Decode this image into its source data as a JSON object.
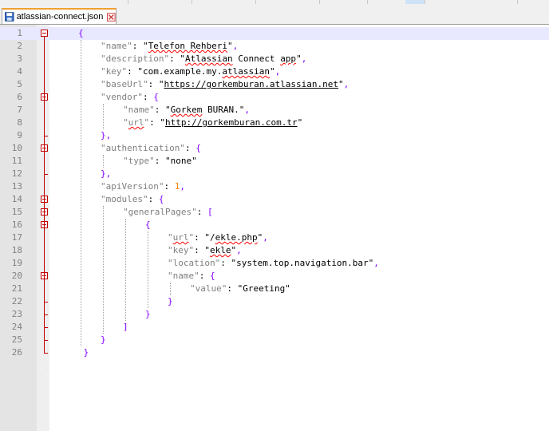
{
  "tab": {
    "title": "atlassian-connect.json",
    "icon": "save-icon",
    "close_icon": "close-icon"
  },
  "editor": {
    "current_line": 1,
    "lines": [
      {
        "n": "1",
        "indent": 0,
        "fold": "open",
        "tokens": [
          {
            "t": "{",
            "c": "p"
          }
        ]
      },
      {
        "n": "2",
        "indent": 1,
        "tokens": [
          {
            "t": "\"name\"",
            "c": "key"
          },
          {
            "t": ": ",
            "c": "kn"
          },
          {
            "t": "\"",
            "c": "q"
          },
          {
            "t": "Telefon Rehberi",
            "c": "sv sq"
          },
          {
            "t": "\"",
            "c": "q"
          },
          {
            "t": ",",
            "c": "p"
          }
        ]
      },
      {
        "n": "3",
        "indent": 1,
        "tokens": [
          {
            "t": "\"description\"",
            "c": "key"
          },
          {
            "t": ": ",
            "c": "kn"
          },
          {
            "t": "\"",
            "c": "q"
          },
          {
            "t": "Atlassian",
            "c": "sv sq"
          },
          {
            "t": " Connect ",
            "c": "sv"
          },
          {
            "t": "app",
            "c": "sv sq"
          },
          {
            "t": "\"",
            "c": "q"
          },
          {
            "t": ",",
            "c": "p"
          }
        ]
      },
      {
        "n": "4",
        "indent": 1,
        "tokens": [
          {
            "t": "\"key\"",
            "c": "key"
          },
          {
            "t": ": ",
            "c": "kn"
          },
          {
            "t": "\"com.example.my.",
            "c": "sv"
          },
          {
            "t": "atlassian",
            "c": "sv sq"
          },
          {
            "t": "\"",
            "c": "q"
          },
          {
            "t": ",",
            "c": "p"
          }
        ]
      },
      {
        "n": "5",
        "indent": 1,
        "tokens": [
          {
            "t": "\"baseUrl\"",
            "c": "key"
          },
          {
            "t": ": ",
            "c": "kn"
          },
          {
            "t": "\"",
            "c": "q"
          },
          {
            "t": "https://gorkemburan.atlassian.net",
            "c": "sv link"
          },
          {
            "t": "\"",
            "c": "q"
          },
          {
            "t": ",",
            "c": "p"
          }
        ]
      },
      {
        "n": "6",
        "indent": 1,
        "fold": "open",
        "tokens": [
          {
            "t": "\"vendor\"",
            "c": "key"
          },
          {
            "t": ": ",
            "c": "kn"
          },
          {
            "t": "{",
            "c": "p"
          }
        ]
      },
      {
        "n": "7",
        "indent": 2,
        "tokens": [
          {
            "t": "\"name\"",
            "c": "key"
          },
          {
            "t": ": ",
            "c": "kn"
          },
          {
            "t": "\"",
            "c": "q"
          },
          {
            "t": "Gorkem",
            "c": "sv sq"
          },
          {
            "t": " BURAN.\"",
            "c": "sv"
          },
          {
            "t": ",",
            "c": "p"
          }
        ]
      },
      {
        "n": "8",
        "indent": 2,
        "tokens": [
          {
            "t": "\"",
            "c": "key"
          },
          {
            "t": "url",
            "c": "key sq"
          },
          {
            "t": "\"",
            "c": "key"
          },
          {
            "t": ": ",
            "c": "kn"
          },
          {
            "t": "\"",
            "c": "q"
          },
          {
            "t": "http://gorkemburan.com.tr",
            "c": "sv link"
          },
          {
            "t": "\"",
            "c": "q"
          }
        ]
      },
      {
        "n": "9",
        "indent": 1,
        "fold": "end",
        "tokens": [
          {
            "t": "},",
            "c": "p"
          }
        ]
      },
      {
        "n": "10",
        "indent": 1,
        "fold": "open",
        "tokens": [
          {
            "t": "\"authentication\"",
            "c": "key"
          },
          {
            "t": ": ",
            "c": "kn"
          },
          {
            "t": "{",
            "c": "p"
          }
        ]
      },
      {
        "n": "11",
        "indent": 2,
        "tokens": [
          {
            "t": "\"type\"",
            "c": "key"
          },
          {
            "t": ": ",
            "c": "kn"
          },
          {
            "t": "\"none\"",
            "c": "sv"
          }
        ]
      },
      {
        "n": "12",
        "indent": 1,
        "fold": "end",
        "tokens": [
          {
            "t": "},",
            "c": "p"
          }
        ]
      },
      {
        "n": "13",
        "indent": 1,
        "tokens": [
          {
            "t": "\"apiVersion\"",
            "c": "key"
          },
          {
            "t": ": ",
            "c": "kn"
          },
          {
            "t": "1",
            "c": "num"
          },
          {
            "t": ",",
            "c": "p"
          }
        ]
      },
      {
        "n": "14",
        "indent": 1,
        "fold": "open",
        "tokens": [
          {
            "t": "\"modules\"",
            "c": "key"
          },
          {
            "t": ": ",
            "c": "kn"
          },
          {
            "t": "{",
            "c": "p"
          }
        ]
      },
      {
        "n": "15",
        "indent": 2,
        "fold": "open",
        "tokens": [
          {
            "t": "\"generalPages\"",
            "c": "key"
          },
          {
            "t": ": ",
            "c": "kn"
          },
          {
            "t": "[",
            "c": "p"
          }
        ]
      },
      {
        "n": "16",
        "indent": 3,
        "fold": "open",
        "tokens": [
          {
            "t": "{",
            "c": "p"
          }
        ]
      },
      {
        "n": "17",
        "indent": 4,
        "tokens": [
          {
            "t": "\"",
            "c": "key"
          },
          {
            "t": "url",
            "c": "key sq"
          },
          {
            "t": "\"",
            "c": "key"
          },
          {
            "t": ": ",
            "c": "kn"
          },
          {
            "t": "\"/",
            "c": "sv"
          },
          {
            "t": "ekle.php",
            "c": "sv sq"
          },
          {
            "t": "\"",
            "c": "q"
          },
          {
            "t": ",",
            "c": "p"
          }
        ]
      },
      {
        "n": "18",
        "indent": 4,
        "tokens": [
          {
            "t": "\"key\"",
            "c": "key"
          },
          {
            "t": ": ",
            "c": "kn"
          },
          {
            "t": "\"",
            "c": "q"
          },
          {
            "t": "ekle",
            "c": "sv sq"
          },
          {
            "t": "\"",
            "c": "q"
          },
          {
            "t": ",",
            "c": "p"
          }
        ]
      },
      {
        "n": "19",
        "indent": 4,
        "tokens": [
          {
            "t": "\"location\"",
            "c": "key"
          },
          {
            "t": ": ",
            "c": "kn"
          },
          {
            "t": "\"system.top.navigation.bar\"",
            "c": "sv"
          },
          {
            "t": ",",
            "c": "p"
          }
        ]
      },
      {
        "n": "20",
        "indent": 4,
        "fold": "open",
        "tokens": [
          {
            "t": "\"name\"",
            "c": "key"
          },
          {
            "t": ": ",
            "c": "kn"
          },
          {
            "t": "{",
            "c": "p"
          }
        ]
      },
      {
        "n": "21",
        "indent": 5,
        "tokens": [
          {
            "t": "\"value\"",
            "c": "key"
          },
          {
            "t": ": ",
            "c": "kn"
          },
          {
            "t": "\"Greeting\"",
            "c": "sv"
          }
        ]
      },
      {
        "n": "22",
        "indent": 4,
        "fold": "end",
        "tokens": [
          {
            "t": "}",
            "c": "p"
          }
        ]
      },
      {
        "n": "23",
        "indent": 3,
        "fold": "end",
        "tokens": [
          {
            "t": "}",
            "c": "p"
          }
        ]
      },
      {
        "n": "24",
        "indent": 2,
        "fold": "end",
        "tokens": [
          {
            "t": "]",
            "c": "p"
          }
        ]
      },
      {
        "n": "25",
        "indent": 1,
        "fold": "end",
        "tokens": [
          {
            "t": "}",
            "c": "p"
          }
        ]
      },
      {
        "n": "26",
        "indent": 0,
        "fold": "end",
        "tokens": [
          {
            "t": " }",
            "c": "p"
          }
        ]
      }
    ]
  }
}
